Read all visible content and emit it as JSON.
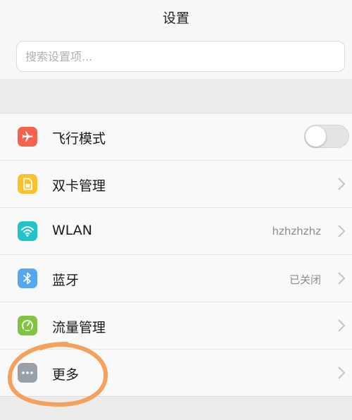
{
  "header": {
    "title": "设置"
  },
  "search": {
    "placeholder": "搜索设置项..."
  },
  "colors": {
    "airplane": "#f5624d",
    "dual_sim": "#fcc22d",
    "wlan": "#22c3c9",
    "bluetooth": "#55a8f0",
    "data_usage": "#82c341",
    "more": "#9aa0a8",
    "annotation": "#f5a15b"
  },
  "settings": {
    "airplane_mode": {
      "label": "飞行模式",
      "icon": "airplane-icon",
      "toggle_on": false
    },
    "dual_sim": {
      "label": "双卡管理",
      "icon": "sim-card-icon"
    },
    "wlan": {
      "label": "WLAN",
      "value": "hzhzhzhz",
      "icon": "wifi-icon"
    },
    "bluetooth": {
      "label": "蓝牙",
      "value": "已关闭",
      "icon": "bluetooth-icon"
    },
    "data_usage": {
      "label": "流量管理",
      "icon": "gauge-icon"
    },
    "more": {
      "label": "更多",
      "icon": "more-dots-icon"
    }
  }
}
